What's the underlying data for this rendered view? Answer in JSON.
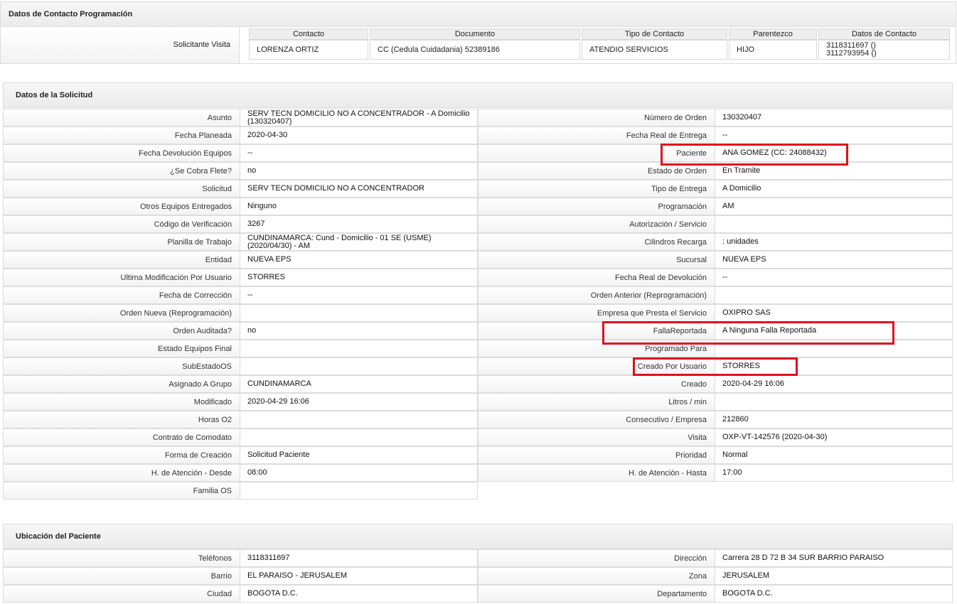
{
  "contact_section": {
    "title": "Datos de Contacto Programación",
    "row_label": "Solicitante Visita",
    "headers": [
      "Contacto",
      "Documento",
      "Tipo de Contacto",
      "Parentezco",
      "Datos de Contacto"
    ],
    "row": [
      "LORENZA ORTIZ",
      "CC (Cedula Cuidadania) 52389186",
      "ATENDIO SERVICIOS",
      "HIJO"
    ],
    "phones": [
      "3118311697 ()",
      "3112793954 ()"
    ]
  },
  "solicitud": {
    "title": "Datos de la Solicitud",
    "left": [
      {
        "label": "Asunto",
        "value": "SERV TECN DOMICILIO NO A CONCENTRADOR - A Domicilio (130320407)"
      },
      {
        "label": "Fecha Planeada",
        "value": "2020-04-30"
      },
      {
        "label": "Fecha Devolución Equipos",
        "value": "--"
      },
      {
        "label": "¿Se Cobra Flete?",
        "value": "no"
      },
      {
        "label": "Solicitud",
        "value": "SERV TECN DOMICILIO NO A CONCENTRADOR"
      },
      {
        "label": "Otros Equipos Entregados",
        "value": "Ninguno"
      },
      {
        "label": "Código de Verificación",
        "value": "3267"
      },
      {
        "label": "Planilla de Trabajo",
        "value": "CUNDINAMARCA: Cund - Domicilio - 01 SE (USME) (2020/04/30) - AM"
      },
      {
        "label": "Entidad",
        "value": "NUEVA EPS"
      },
      {
        "label": "Ultima Modificación Por Usuario",
        "value": "STORRES"
      },
      {
        "label": "Fecha de Corrección",
        "value": "--"
      },
      {
        "label": "Orden Nueva (Reprogramación)",
        "value": ""
      },
      {
        "label": "Orden Auditada?",
        "value": "no"
      },
      {
        "label": "Estado Equipos Final",
        "value": ""
      },
      {
        "label": "SubEstadoOS",
        "value": ""
      },
      {
        "label": "Asignado A Grupo",
        "value": "CUNDINAMARCA"
      },
      {
        "label": "Modificado",
        "value": "2020-04-29 16:06"
      },
      {
        "label": "Horas O2",
        "value": ""
      },
      {
        "label": "Contrato de Comodato",
        "value": ""
      },
      {
        "label": "Forma de Creación",
        "value": "Solicitud Paciente"
      },
      {
        "label": "H. de Atención - Desde",
        "value": "08:00"
      },
      {
        "label": "Familia OS",
        "value": ""
      }
    ],
    "right": [
      {
        "label": "Número de Orden",
        "value": "130320407"
      },
      {
        "label": "Fecha Real de Entrega",
        "value": "--"
      },
      {
        "label": "Paciente",
        "value": "ANA GOMEZ (CC: 24088432)"
      },
      {
        "label": "Estado de Orden",
        "value": "En Tramite"
      },
      {
        "label": "Tipo de Entrega",
        "value": "A Domicilio"
      },
      {
        "label": "Programación",
        "value": "AM"
      },
      {
        "label": "Autorización / Servicio",
        "value": ""
      },
      {
        "label": "Cilindros Recarga",
        "value": ": unidades"
      },
      {
        "label": "Sucursal",
        "value": "NUEVA EPS"
      },
      {
        "label": "Fecha Real de Devolución",
        "value": "--"
      },
      {
        "label": "Orden Anterior (Reprogramación)",
        "value": ""
      },
      {
        "label": "Empresa que Presta el Servicio",
        "value": "OXIPRO SAS"
      },
      {
        "label": "FallaReportada",
        "value": "A Ninguna Falla Reportada"
      },
      {
        "label": "Programado Para",
        "value": ""
      },
      {
        "label": "Creado Por Usuario",
        "value": "STORRES"
      },
      {
        "label": "Creado",
        "value": "2020-04-29 16:06"
      },
      {
        "label": "Litros / min",
        "value": ""
      },
      {
        "label": "Consecutivo / Empresa",
        "value": "212860"
      },
      {
        "label": "Visita",
        "value": "OXP-VT-142576 (2020-04-30)"
      },
      {
        "label": "Prioridad",
        "value": "Normal"
      },
      {
        "label": "H. de Atención - Hasta",
        "value": "17:00"
      }
    ]
  },
  "ubicacion": {
    "title": "Ubicación del Paciente",
    "left": [
      {
        "label": "Teléfonos",
        "value": "3118311697"
      },
      {
        "label": "Barrio",
        "value": "EL PARAISO - JERUSALEM"
      },
      {
        "label": "Ciudad",
        "value": "BOGOTA D.C."
      }
    ],
    "right": [
      {
        "label": "Dirección",
        "value": "Carrera 28 D 72 B 34 SUR BARRIO PARAISO"
      },
      {
        "label": "Zona",
        "value": "JERUSALEM"
      },
      {
        "label": "Departamento",
        "value": "BOGOTA D.C."
      }
    ]
  },
  "highlight_color": "#e0101e"
}
